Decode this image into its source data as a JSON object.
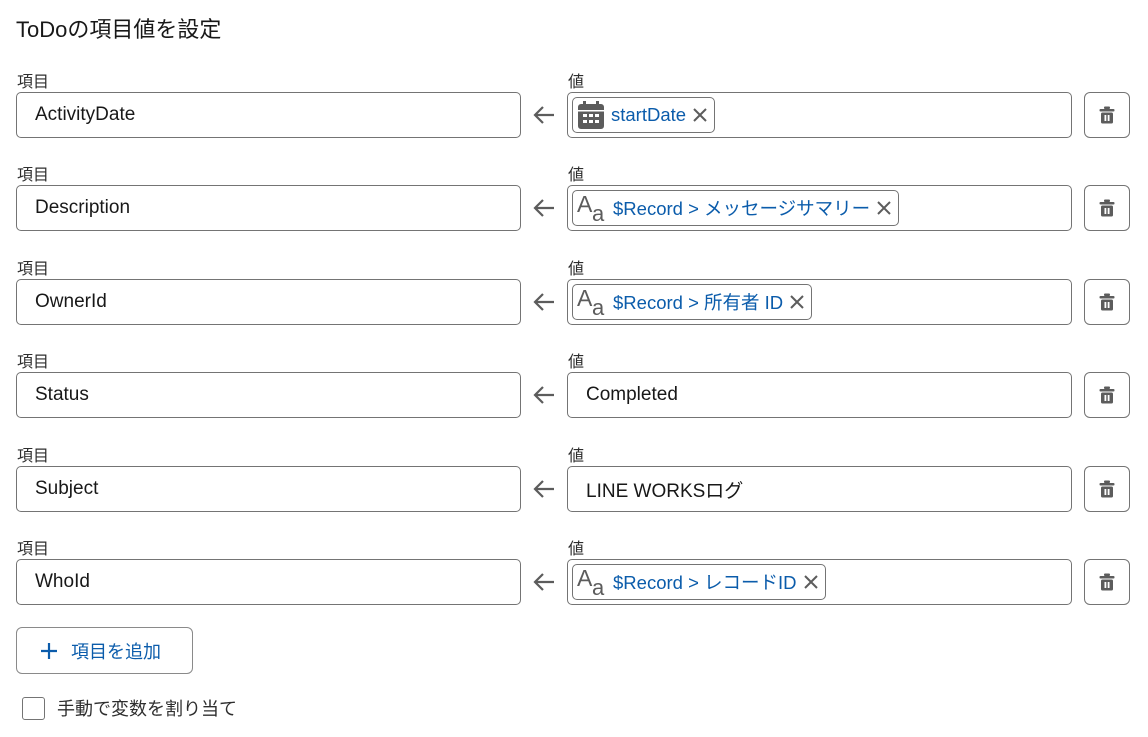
{
  "title": "ToDoの項目値を設定",
  "field_label": "項目",
  "value_label": "値",
  "rows": [
    {
      "field": "ActivityDate",
      "value_type": "resource",
      "value_icon": "calendar-icon",
      "value": "startDate"
    },
    {
      "field": "Description",
      "value_type": "resource",
      "value_icon": "text-icon",
      "value": "$Record > メッセージサマリー"
    },
    {
      "field": "OwnerId",
      "value_type": "resource",
      "value_icon": "text-icon",
      "value": "$Record > 所有者 ID"
    },
    {
      "field": "Status",
      "value_type": "literal",
      "value": "Completed"
    },
    {
      "field": "Subject",
      "value_type": "literal",
      "value": "LINE WORKSログ"
    },
    {
      "field": "WhoId",
      "value_type": "resource",
      "value_icon": "text-icon",
      "value": "$Record > レコードID"
    }
  ],
  "add_button_label": "項目を追加",
  "manual_assign_label": "手動で変数を割り当て",
  "manual_assign_checked": false,
  "colors": {
    "accent": "#0b5cab",
    "border": "#747474",
    "icon": "#5c5c5c"
  }
}
